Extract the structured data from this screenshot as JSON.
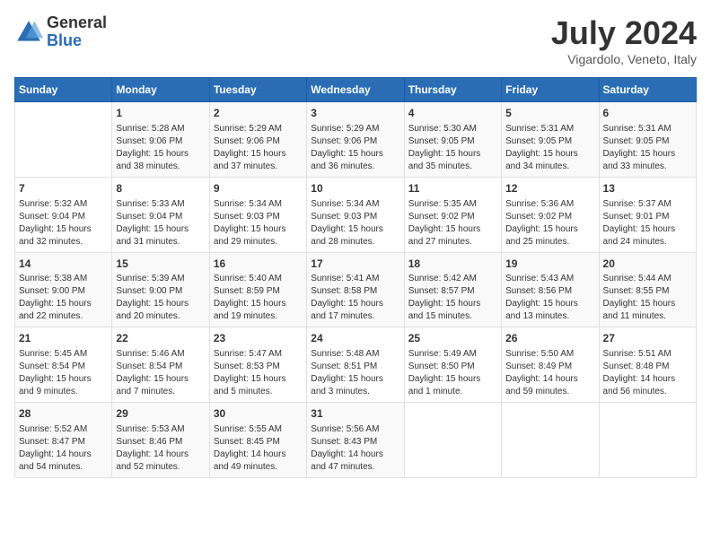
{
  "header": {
    "logo_general": "General",
    "logo_blue": "Blue",
    "month_title": "July 2024",
    "location": "Vigardolo, Veneto, Italy"
  },
  "days_of_week": [
    "Sunday",
    "Monday",
    "Tuesday",
    "Wednesday",
    "Thursday",
    "Friday",
    "Saturday"
  ],
  "weeks": [
    [
      {
        "day": "",
        "info": ""
      },
      {
        "day": "1",
        "info": "Sunrise: 5:28 AM\nSunset: 9:06 PM\nDaylight: 15 hours\nand 38 minutes."
      },
      {
        "day": "2",
        "info": "Sunrise: 5:29 AM\nSunset: 9:06 PM\nDaylight: 15 hours\nand 37 minutes."
      },
      {
        "day": "3",
        "info": "Sunrise: 5:29 AM\nSunset: 9:06 PM\nDaylight: 15 hours\nand 36 minutes."
      },
      {
        "day": "4",
        "info": "Sunrise: 5:30 AM\nSunset: 9:05 PM\nDaylight: 15 hours\nand 35 minutes."
      },
      {
        "day": "5",
        "info": "Sunrise: 5:31 AM\nSunset: 9:05 PM\nDaylight: 15 hours\nand 34 minutes."
      },
      {
        "day": "6",
        "info": "Sunrise: 5:31 AM\nSunset: 9:05 PM\nDaylight: 15 hours\nand 33 minutes."
      }
    ],
    [
      {
        "day": "7",
        "info": "Sunrise: 5:32 AM\nSunset: 9:04 PM\nDaylight: 15 hours\nand 32 minutes."
      },
      {
        "day": "8",
        "info": "Sunrise: 5:33 AM\nSunset: 9:04 PM\nDaylight: 15 hours\nand 31 minutes."
      },
      {
        "day": "9",
        "info": "Sunrise: 5:34 AM\nSunset: 9:03 PM\nDaylight: 15 hours\nand 29 minutes."
      },
      {
        "day": "10",
        "info": "Sunrise: 5:34 AM\nSunset: 9:03 PM\nDaylight: 15 hours\nand 28 minutes."
      },
      {
        "day": "11",
        "info": "Sunrise: 5:35 AM\nSunset: 9:02 PM\nDaylight: 15 hours\nand 27 minutes."
      },
      {
        "day": "12",
        "info": "Sunrise: 5:36 AM\nSunset: 9:02 PM\nDaylight: 15 hours\nand 25 minutes."
      },
      {
        "day": "13",
        "info": "Sunrise: 5:37 AM\nSunset: 9:01 PM\nDaylight: 15 hours\nand 24 minutes."
      }
    ],
    [
      {
        "day": "14",
        "info": "Sunrise: 5:38 AM\nSunset: 9:00 PM\nDaylight: 15 hours\nand 22 minutes."
      },
      {
        "day": "15",
        "info": "Sunrise: 5:39 AM\nSunset: 9:00 PM\nDaylight: 15 hours\nand 20 minutes."
      },
      {
        "day": "16",
        "info": "Sunrise: 5:40 AM\nSunset: 8:59 PM\nDaylight: 15 hours\nand 19 minutes."
      },
      {
        "day": "17",
        "info": "Sunrise: 5:41 AM\nSunset: 8:58 PM\nDaylight: 15 hours\nand 17 minutes."
      },
      {
        "day": "18",
        "info": "Sunrise: 5:42 AM\nSunset: 8:57 PM\nDaylight: 15 hours\nand 15 minutes."
      },
      {
        "day": "19",
        "info": "Sunrise: 5:43 AM\nSunset: 8:56 PM\nDaylight: 15 hours\nand 13 minutes."
      },
      {
        "day": "20",
        "info": "Sunrise: 5:44 AM\nSunset: 8:55 PM\nDaylight: 15 hours\nand 11 minutes."
      }
    ],
    [
      {
        "day": "21",
        "info": "Sunrise: 5:45 AM\nSunset: 8:54 PM\nDaylight: 15 hours\nand 9 minutes."
      },
      {
        "day": "22",
        "info": "Sunrise: 5:46 AM\nSunset: 8:54 PM\nDaylight: 15 hours\nand 7 minutes."
      },
      {
        "day": "23",
        "info": "Sunrise: 5:47 AM\nSunset: 8:53 PM\nDaylight: 15 hours\nand 5 minutes."
      },
      {
        "day": "24",
        "info": "Sunrise: 5:48 AM\nSunset: 8:51 PM\nDaylight: 15 hours\nand 3 minutes."
      },
      {
        "day": "25",
        "info": "Sunrise: 5:49 AM\nSunset: 8:50 PM\nDaylight: 15 hours\nand 1 minute."
      },
      {
        "day": "26",
        "info": "Sunrise: 5:50 AM\nSunset: 8:49 PM\nDaylight: 14 hours\nand 59 minutes."
      },
      {
        "day": "27",
        "info": "Sunrise: 5:51 AM\nSunset: 8:48 PM\nDaylight: 14 hours\nand 56 minutes."
      }
    ],
    [
      {
        "day": "28",
        "info": "Sunrise: 5:52 AM\nSunset: 8:47 PM\nDaylight: 14 hours\nand 54 minutes."
      },
      {
        "day": "29",
        "info": "Sunrise: 5:53 AM\nSunset: 8:46 PM\nDaylight: 14 hours\nand 52 minutes."
      },
      {
        "day": "30",
        "info": "Sunrise: 5:55 AM\nSunset: 8:45 PM\nDaylight: 14 hours\nand 49 minutes."
      },
      {
        "day": "31",
        "info": "Sunrise: 5:56 AM\nSunset: 8:43 PM\nDaylight: 14 hours\nand 47 minutes."
      },
      {
        "day": "",
        "info": ""
      },
      {
        "day": "",
        "info": ""
      },
      {
        "day": "",
        "info": ""
      }
    ]
  ]
}
